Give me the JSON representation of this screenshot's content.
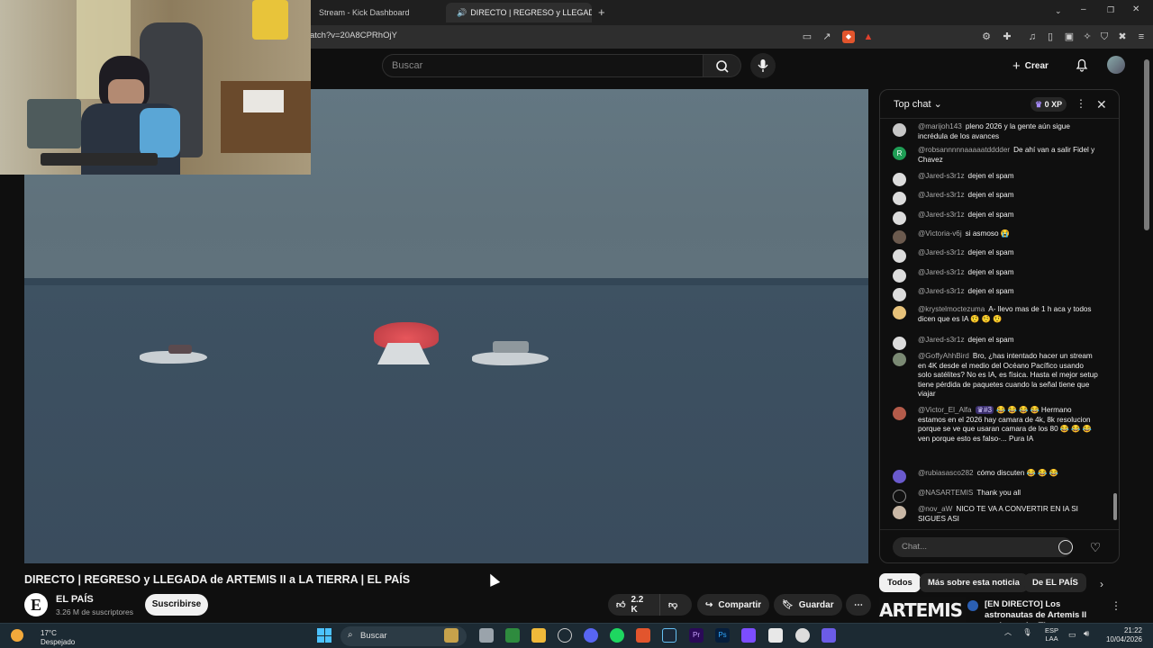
{
  "browser": {
    "tabs": [
      {
        "label": "Stream - Kick Dashboard"
      },
      {
        "label": "DIRECTO | REGRESO y LLEGAD"
      }
    ],
    "url": "atch?v=20A8CPRhOjY"
  },
  "header": {
    "search_placeholder": "Buscar",
    "create_label": "Crear"
  },
  "video": {
    "title": "DIRECTO | REGRESO y LLEGADA de ARTEMIS II a LA TIERRA | EL PAÍS",
    "channel": {
      "initial": "E",
      "name": "EL PAÍS",
      "subscribers": "3.26 M de suscriptores",
      "subscribe_label": "Suscribirse"
    },
    "actions": {
      "likes": "2.2 K",
      "share_label": "Compartir",
      "save_label": "Guardar"
    }
  },
  "chat": {
    "mode": "Top chat",
    "xp": "0 XP",
    "input_placeholder": "Chat...",
    "messages": [
      {
        "author": "@marijoh143",
        "text": "pleno 2026 y la gente aún sigue incrédula de los avances"
      },
      {
        "author": "@robsannnnnaaaaatdddder",
        "text": "De ahí van a salir Fidel y Chavez"
      },
      {
        "author": "@Jared-s3r1z",
        "text": "dejen el spam"
      },
      {
        "author": "@Jared-s3r1z",
        "text": "dejen el spam"
      },
      {
        "author": "@Jared-s3r1z",
        "text": "dejen el spam"
      },
      {
        "author": "@Victoria-v6j",
        "text": "si asmoso 😭"
      },
      {
        "author": "@Jared-s3r1z",
        "text": "dejen el spam"
      },
      {
        "author": "@Jared-s3r1z",
        "text": "dejen el spam"
      },
      {
        "author": "@Jared-s3r1z",
        "text": "dejen el spam"
      },
      {
        "author": "@krystelmoctezuma",
        "text": "A- llevo mas de 1 h aca y todos dicen que es IA 🤨 🤨 🤨"
      },
      {
        "author": "@Jared-s3r1z",
        "text": "dejen el spam"
      },
      {
        "author": "@GoffyAhhBird",
        "text": "Bro, ¿has intentado hacer un stream en 4K desde el medio del Océano Pacífico usando solo satélites? No es IA, es física. Hasta el mejor setup tiene pérdida de paquetes cuando la señal tiene que viajar"
      },
      {
        "author": "@Victor_El_Alfa",
        "badge": "#3",
        "text": "😂 😂 😂 😂 Hermano estamos en el 2026 hay camara de 4k, 8k resolucion porque se ve que usaran camara de los 80 😂 😂 😂 ven porque esto es falso-... Pura IA"
      },
      {
        "author": "@rubiasasco282",
        "text": "cómo discuten 😂 😂 😂"
      },
      {
        "author": "@NASARTEMIS",
        "text": "Thank you all"
      },
      {
        "author": "@nov_aW",
        "text": "NICO TE VA A CONVERTIR EN IA SI SIGUES ASI"
      }
    ]
  },
  "chips": [
    "Todos",
    "Más sobre esta noticia",
    "De EL PAÍS"
  ],
  "related": {
    "thumb_text": "ARTEMIS II",
    "title": "[EN DIRECTO] Los astronautas de Artemis II vuelven a La Tier..."
  },
  "taskbar": {
    "weather_temp": "17°C",
    "weather_desc": "Despejado",
    "search_label": "Buscar",
    "lang_line1": "ESP",
    "lang_line2": "LAA",
    "time": "21:22",
    "date": "10/04/2026"
  },
  "colors": {
    "page_bg": "#0f0f0f",
    "accent_purple": "#7b5cff",
    "chute_red": "#d84a50"
  }
}
